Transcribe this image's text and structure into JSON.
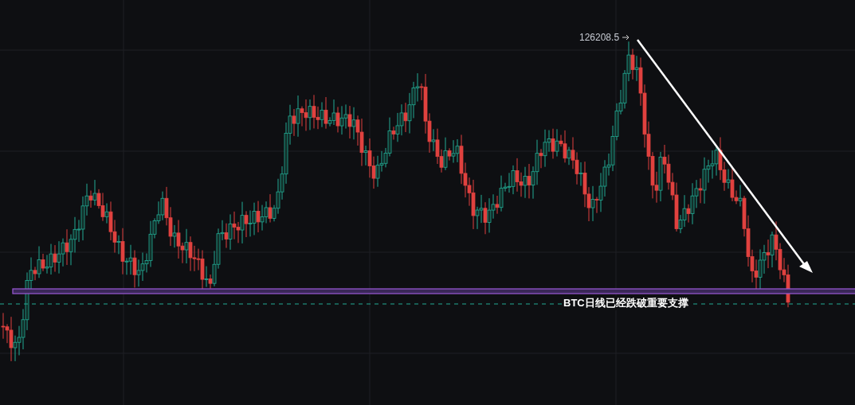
{
  "chart": {
    "peak_label": "126208.5",
    "annotation": "BTC日线已经跌破重要支撑"
  }
}
